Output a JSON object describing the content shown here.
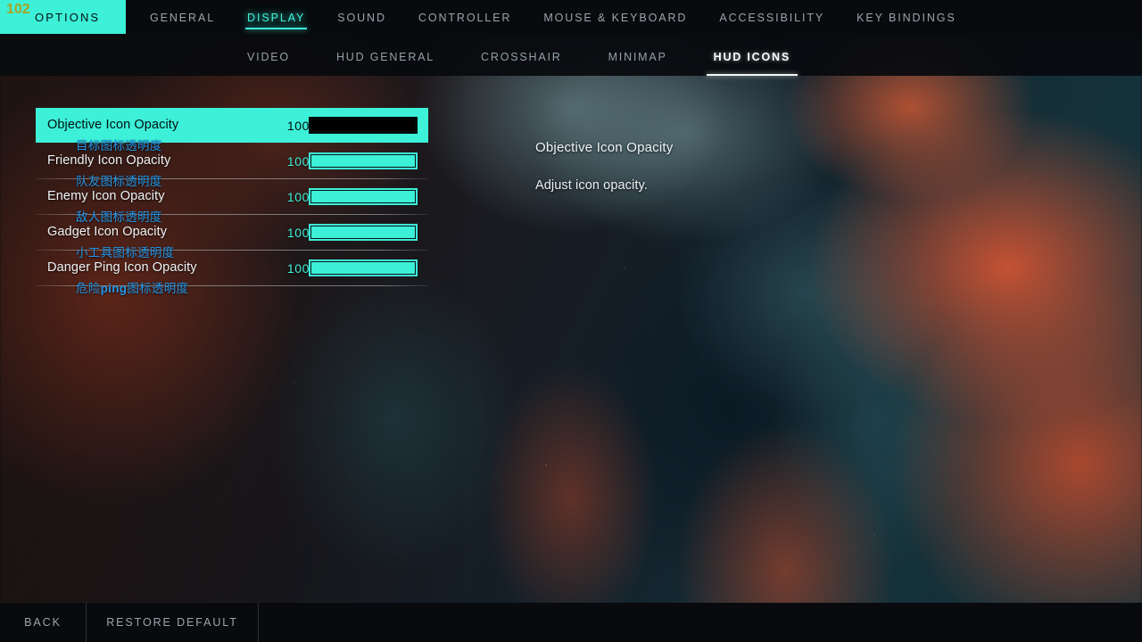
{
  "header": {
    "counter": "102",
    "options_label": "OPTIONS",
    "main_tabs": [
      {
        "label": "GENERAL",
        "active": false
      },
      {
        "label": "DISPLAY",
        "active": true
      },
      {
        "label": "SOUND",
        "active": false
      },
      {
        "label": "CONTROLLER",
        "active": false
      },
      {
        "label": "MOUSE & KEYBOARD",
        "active": false
      },
      {
        "label": "ACCESSIBILITY",
        "active": false
      },
      {
        "label": "KEY BINDINGS",
        "active": false
      }
    ],
    "sub_tabs": [
      {
        "label": "VIDEO",
        "active": false
      },
      {
        "label": "HUD GENERAL",
        "active": false
      },
      {
        "label": "CROSSHAIR",
        "active": false
      },
      {
        "label": "MINIMAP",
        "active": false
      },
      {
        "label": "HUD ICONS",
        "active": true
      }
    ]
  },
  "settings": [
    {
      "label": "Objective Icon Opacity",
      "subtitle_pre": "目标图标透明度",
      "subtitle_bold": "",
      "subtitle_post": "",
      "value": "100",
      "fill_percent": 100,
      "selected": true
    },
    {
      "label": "Friendly Icon Opacity",
      "subtitle_pre": "队友图标透明度",
      "subtitle_bold": "",
      "subtitle_post": "",
      "value": "100",
      "fill_percent": 100,
      "selected": false
    },
    {
      "label": "Enemy Icon Opacity",
      "subtitle_pre": "敌人图标透明度",
      "subtitle_bold": "",
      "subtitle_post": "",
      "value": "100",
      "fill_percent": 100,
      "selected": false
    },
    {
      "label": "Gadget Icon Opacity",
      "subtitle_pre": "小工具图标透明度",
      "subtitle_bold": "",
      "subtitle_post": "",
      "value": "100",
      "fill_percent": 100,
      "selected": false
    },
    {
      "label": "Danger Ping Icon Opacity",
      "subtitle_pre": "危险",
      "subtitle_bold": "ping",
      "subtitle_post": "图标透明度",
      "value": "100",
      "fill_percent": 100,
      "selected": false
    }
  ],
  "description": {
    "title": "Objective Icon Opacity",
    "body": "Adjust icon opacity."
  },
  "footer": {
    "back_label": "BACK",
    "restore_label": "RESTORE DEFAULT"
  },
  "colors": {
    "accent_cyan": "#3df0d8",
    "counter_olive": "#a9a324",
    "subtitle_blue": "#2196e8",
    "inactive_text": "#9aa4ab",
    "active_subtab": "#ffffff",
    "bar_black": "#080a0d"
  }
}
